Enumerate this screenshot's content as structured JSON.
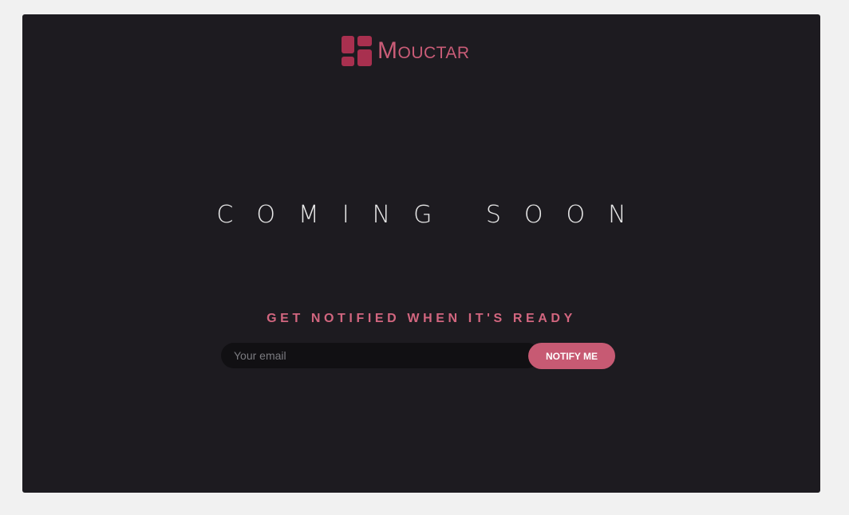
{
  "brand": {
    "name": "Mouctar",
    "logo_icon": "dashboard-tiles-icon",
    "color": "#c95c77"
  },
  "hero": {
    "headline": "COMING SOON"
  },
  "signup": {
    "subheading": "GET NOTIFIED WHEN IT'S READY",
    "email_placeholder": "Your email",
    "email_value": "",
    "button_label": "NOTIFY ME",
    "button_color": "#c75a73"
  },
  "colors": {
    "page_background": "#f1f1f1",
    "panel_background": "#1d1b20",
    "accent": "#c95c77"
  }
}
